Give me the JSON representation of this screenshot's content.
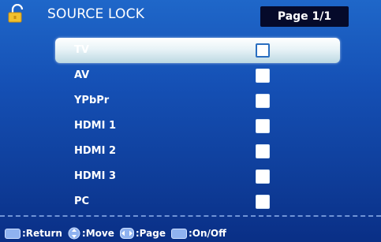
{
  "header": {
    "title": "SOURCE LOCK",
    "page_indicator": "Page 1/1",
    "icon": "padlock-icon"
  },
  "sources": [
    {
      "label": "TV",
      "checked": false,
      "selected": true
    },
    {
      "label": "AV",
      "checked": false,
      "selected": false
    },
    {
      "label": "YPbPr",
      "checked": false,
      "selected": false
    },
    {
      "label": "HDMI 1",
      "checked": false,
      "selected": false
    },
    {
      "label": "HDMI 2",
      "checked": false,
      "selected": false
    },
    {
      "label": "HDMI 3",
      "checked": false,
      "selected": false
    },
    {
      "label": "PC",
      "checked": false,
      "selected": false
    }
  ],
  "footer": {
    "return": {
      "label": ":Return",
      "icon": "menu-key-icon"
    },
    "move": {
      "label": ":Move",
      "icon": "up-down-arrows-icon"
    },
    "page": {
      "label": ":Page",
      "icon": "left-right-arrows-icon"
    },
    "toggle": {
      "label": ":On/Off",
      "icon": "enter-key-icon"
    }
  },
  "colors": {
    "background_top": "#1f67c9",
    "background_bottom": "#0a2f86",
    "highlight": "#e8f3f7",
    "page_box": "#050a2a",
    "padlock": "#f2c12e"
  }
}
